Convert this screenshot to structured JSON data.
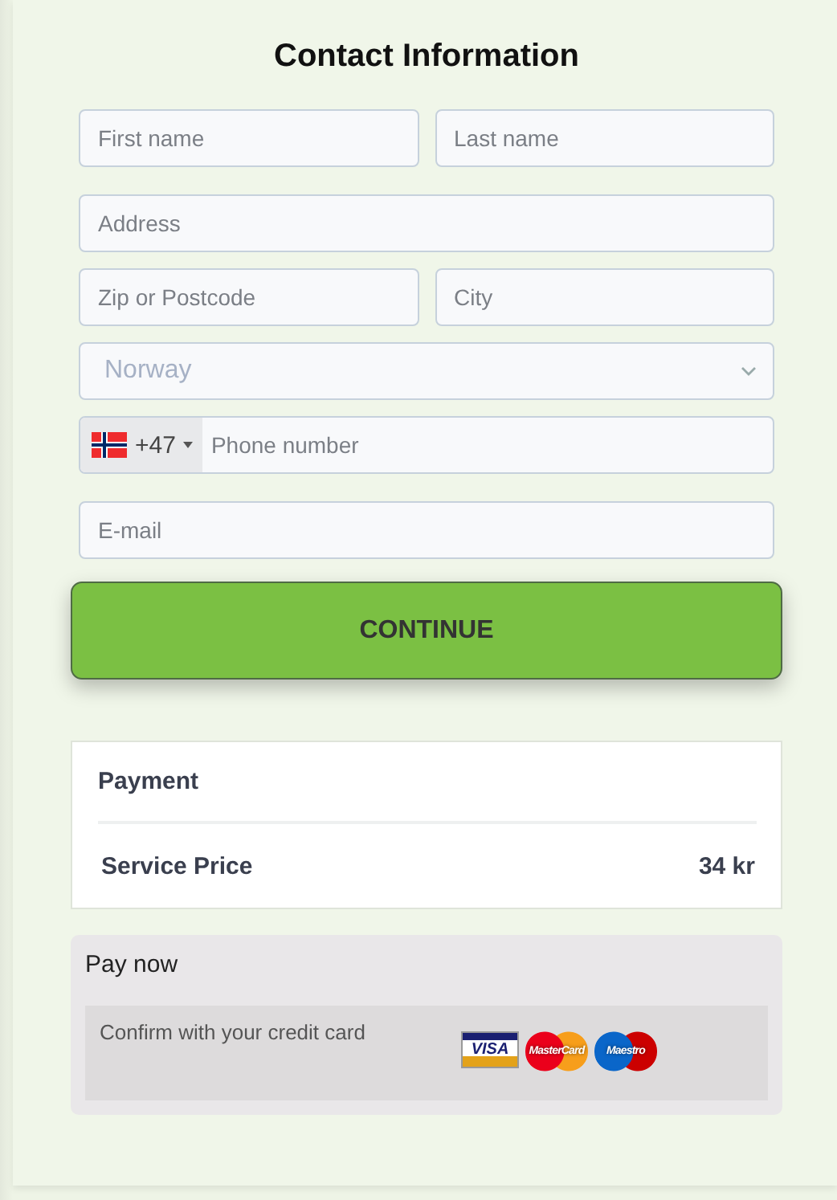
{
  "title": "Contact Information",
  "fields": {
    "first_name": {
      "placeholder": "First name"
    },
    "last_name": {
      "placeholder": "Last name"
    },
    "address": {
      "placeholder": "Address"
    },
    "zip": {
      "placeholder": "Zip or Postcode"
    },
    "city": {
      "placeholder": "City"
    },
    "country": {
      "value": "Norway"
    },
    "phone": {
      "dial_code": "+47",
      "placeholder": "Phone number"
    },
    "email": {
      "placeholder": "E-mail"
    }
  },
  "continue_button": "CONTINUE",
  "payment": {
    "title": "Payment",
    "line_label": "Service Price",
    "line_value": "34 kr"
  },
  "pay_now": {
    "title": "Pay now",
    "note": "Confirm with your credit card",
    "cards": [
      {
        "kind": "visa",
        "label": "VISA"
      },
      {
        "kind": "mastercard",
        "label": "MasterCard"
      },
      {
        "kind": "maestro",
        "label": "Maestro"
      }
    ]
  }
}
